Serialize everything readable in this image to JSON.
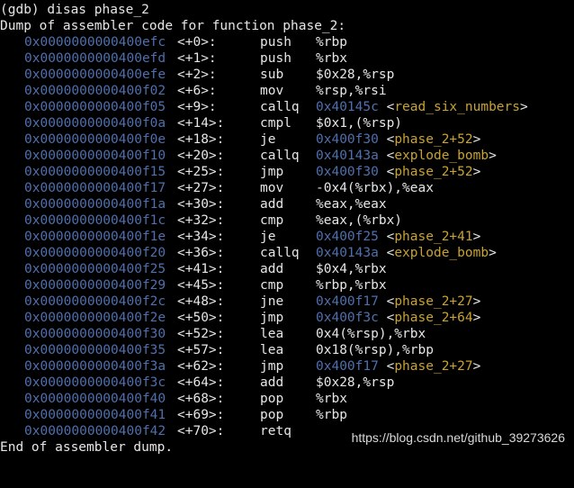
{
  "terminal": {
    "command": "(gdb) disas phase_2",
    "header": "Dump of assembler code for function phase_2:",
    "footer": "End of assembler dump.",
    "colors": {
      "background": "#000000",
      "text": "#e6e6e6",
      "address": "#4f6fae",
      "symbol": "#c9a230"
    },
    "instructions": [
      {
        "addr": "0x0000000000400efc",
        "offset": "<+0>:",
        "mnemonic": "push",
        "operands": "%rbp",
        "target": "",
        "symbol": ""
      },
      {
        "addr": "0x0000000000400efd",
        "offset": "<+1>:",
        "mnemonic": "push",
        "operands": "%rbx",
        "target": "",
        "symbol": ""
      },
      {
        "addr": "0x0000000000400efe",
        "offset": "<+2>:",
        "mnemonic": "sub",
        "operands": "$0x28,%rsp",
        "target": "",
        "symbol": ""
      },
      {
        "addr": "0x0000000000400f02",
        "offset": "<+6>:",
        "mnemonic": "mov",
        "operands": "%rsp,%rsi",
        "target": "",
        "symbol": ""
      },
      {
        "addr": "0x0000000000400f05",
        "offset": "<+9>:",
        "mnemonic": "callq",
        "operands": "",
        "target": "0x40145c",
        "symbol": "read_six_numbers"
      },
      {
        "addr": "0x0000000000400f0a",
        "offset": "<+14>:",
        "mnemonic": "cmpl",
        "operands": "$0x1,(%rsp)",
        "target": "",
        "symbol": ""
      },
      {
        "addr": "0x0000000000400f0e",
        "offset": "<+18>:",
        "mnemonic": "je",
        "operands": "",
        "target": "0x400f30",
        "symbol": "phase_2+52"
      },
      {
        "addr": "0x0000000000400f10",
        "offset": "<+20>:",
        "mnemonic": "callq",
        "operands": "",
        "target": "0x40143a",
        "symbol": "explode_bomb"
      },
      {
        "addr": "0x0000000000400f15",
        "offset": "<+25>:",
        "mnemonic": "jmp",
        "operands": "",
        "target": "0x400f30",
        "symbol": "phase_2+52"
      },
      {
        "addr": "0x0000000000400f17",
        "offset": "<+27>:",
        "mnemonic": "mov",
        "operands": "-0x4(%rbx),%eax",
        "target": "",
        "symbol": ""
      },
      {
        "addr": "0x0000000000400f1a",
        "offset": "<+30>:",
        "mnemonic": "add",
        "operands": "%eax,%eax",
        "target": "",
        "symbol": ""
      },
      {
        "addr": "0x0000000000400f1c",
        "offset": "<+32>:",
        "mnemonic": "cmp",
        "operands": "%eax,(%rbx)",
        "target": "",
        "symbol": ""
      },
      {
        "addr": "0x0000000000400f1e",
        "offset": "<+34>:",
        "mnemonic": "je",
        "operands": "",
        "target": "0x400f25",
        "symbol": "phase_2+41"
      },
      {
        "addr": "0x0000000000400f20",
        "offset": "<+36>:",
        "mnemonic": "callq",
        "operands": "",
        "target": "0x40143a",
        "symbol": "explode_bomb"
      },
      {
        "addr": "0x0000000000400f25",
        "offset": "<+41>:",
        "mnemonic": "add",
        "operands": "$0x4,%rbx",
        "target": "",
        "symbol": ""
      },
      {
        "addr": "0x0000000000400f29",
        "offset": "<+45>:",
        "mnemonic": "cmp",
        "operands": "%rbp,%rbx",
        "target": "",
        "symbol": ""
      },
      {
        "addr": "0x0000000000400f2c",
        "offset": "<+48>:",
        "mnemonic": "jne",
        "operands": "",
        "target": "0x400f17",
        "symbol": "phase_2+27"
      },
      {
        "addr": "0x0000000000400f2e",
        "offset": "<+50>:",
        "mnemonic": "jmp",
        "operands": "",
        "target": "0x400f3c",
        "symbol": "phase_2+64"
      },
      {
        "addr": "0x0000000000400f30",
        "offset": "<+52>:",
        "mnemonic": "lea",
        "operands": "0x4(%rsp),%rbx",
        "target": "",
        "symbol": ""
      },
      {
        "addr": "0x0000000000400f35",
        "offset": "<+57>:",
        "mnemonic": "lea",
        "operands": "0x18(%rsp),%rbp",
        "target": "",
        "symbol": ""
      },
      {
        "addr": "0x0000000000400f3a",
        "offset": "<+62>:",
        "mnemonic": "jmp",
        "operands": "",
        "target": "0x400f17",
        "symbol": "phase_2+27"
      },
      {
        "addr": "0x0000000000400f3c",
        "offset": "<+64>:",
        "mnemonic": "add",
        "operands": "$0x28,%rsp",
        "target": "",
        "symbol": ""
      },
      {
        "addr": "0x0000000000400f40",
        "offset": "<+68>:",
        "mnemonic": "pop",
        "operands": "%rbx",
        "target": "",
        "symbol": ""
      },
      {
        "addr": "0x0000000000400f41",
        "offset": "<+69>:",
        "mnemonic": "pop",
        "operands": "%rbp",
        "target": "",
        "symbol": ""
      },
      {
        "addr": "0x0000000000400f42",
        "offset": "<+70>:",
        "mnemonic": "retq",
        "operands": "",
        "target": "",
        "symbol": ""
      }
    ]
  },
  "watermark": "https://blog.csdn.net/github_39273626"
}
